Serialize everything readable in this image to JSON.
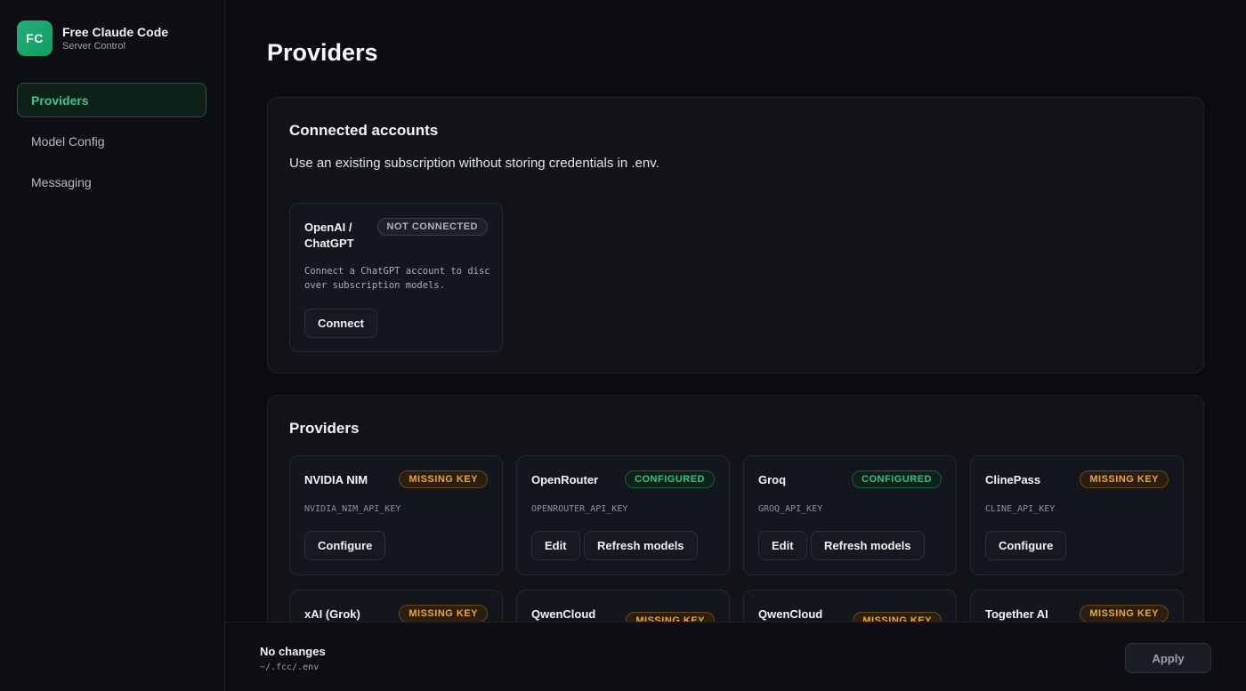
{
  "brand": {
    "logo": "FC",
    "name": "Free Claude Code",
    "subtitle": "Server Control"
  },
  "nav": [
    {
      "label": "Providers",
      "active": true
    },
    {
      "label": "Model Config",
      "active": false
    },
    {
      "label": "Messaging",
      "active": false
    }
  ],
  "page": {
    "title": "Providers"
  },
  "accounts": {
    "title": "Connected accounts",
    "description": "Use an existing subscription without storing credentials in .env.",
    "card": {
      "name_line1": "OpenAI /",
      "name_line2": "ChatGPT",
      "badge": "NOT CONNECTED",
      "description": "Connect a ChatGPT account to discover subscription models.",
      "button": "Connect"
    }
  },
  "providers": {
    "title": "Providers",
    "cards": [
      {
        "name": "NVIDIA NIM",
        "badge": "MISSING KEY",
        "env": "NVIDIA_NIM_API_KEY",
        "btn1": "Configure"
      },
      {
        "name": "OpenRouter",
        "badge": "CONFIGURED",
        "env": "OPENROUTER_API_KEY",
        "btn1": "Edit",
        "btn2": "Refresh models"
      },
      {
        "name": "Groq",
        "badge": "CONFIGURED",
        "env": "GROQ_API_KEY",
        "btn1": "Edit",
        "btn2": "Refresh models"
      },
      {
        "name": "ClinePass",
        "badge": "MISSING KEY",
        "env": "CLINE_API_KEY",
        "btn1": "Configure"
      },
      {
        "name": "xAI (Grok)",
        "badge": "MISSING KEY"
      },
      {
        "name": "QwenCloud",
        "badge": "MISSING KEY"
      },
      {
        "name": "QwenCloud",
        "badge": "MISSING KEY"
      },
      {
        "name": "Together AI",
        "badge": "MISSING KEY"
      }
    ]
  },
  "footer": {
    "status": "No changes",
    "path": "~/.fcc/.env",
    "apply": "Apply"
  },
  "colors": {
    "accent": "#22b07a",
    "warning": "#f0a53a",
    "success": "#2fc486"
  },
  "icons": {
    "logo": "fc-logo-icon"
  }
}
